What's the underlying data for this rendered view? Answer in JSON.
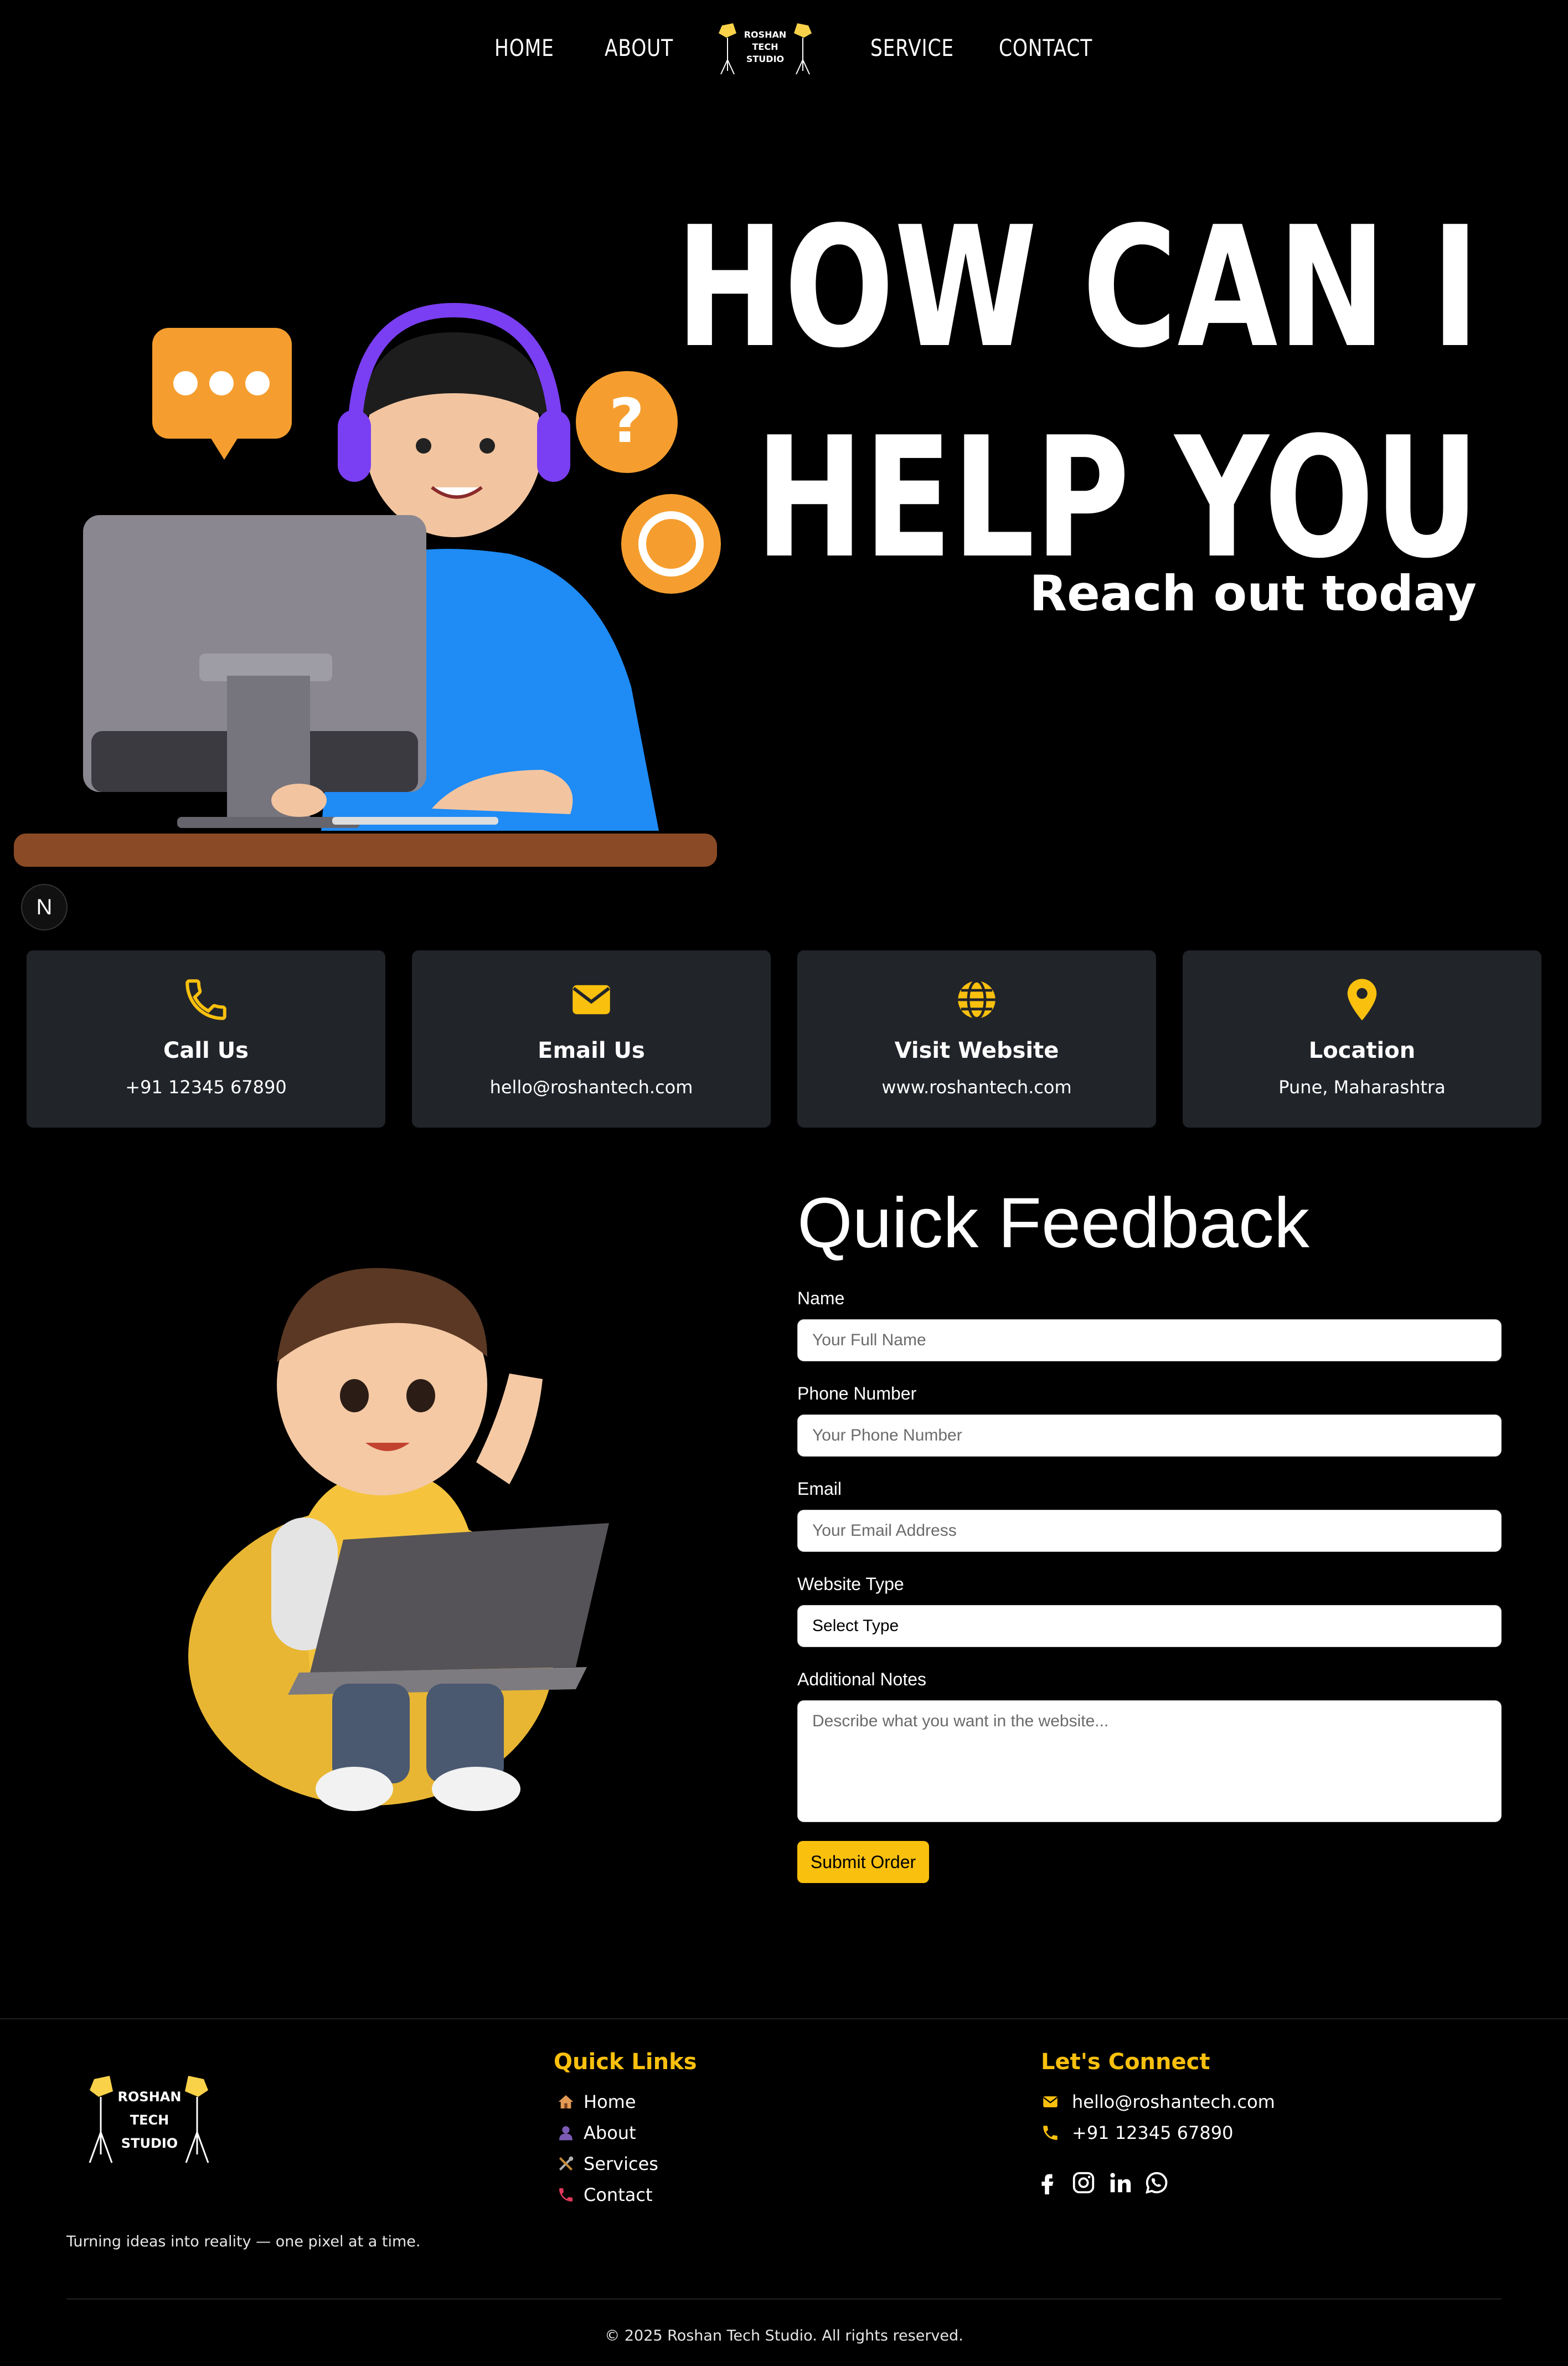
{
  "nav": {
    "links": [
      "HOME",
      "ABOUT",
      "SERVICE",
      "CONTACT"
    ],
    "logo": {
      "line1": "ROSHAN",
      "line2": "TECH",
      "line3": "STUDIO"
    }
  },
  "hero": {
    "title_line1": "HOW CAN I",
    "title_line2": "HELP YOU",
    "subtitle": "Reach out today",
    "badge": "N"
  },
  "cards": [
    {
      "title": "Call Us",
      "value": "+91 12345 67890",
      "icon": "phone-icon"
    },
    {
      "title": "Email Us",
      "value": "hello@roshantech.com",
      "icon": "envelope-icon"
    },
    {
      "title": "Visit Website",
      "value": "www.roshantech.com",
      "icon": "globe-icon"
    },
    {
      "title": "Location",
      "value": "Pune, Maharashtra",
      "icon": "map-pin-icon"
    }
  ],
  "feedback": {
    "title": "Quick Feedback",
    "name_label": "Name",
    "name_placeholder": "Your Full Name",
    "phone_label": "Phone Number",
    "phone_placeholder": "Your Phone Number",
    "email_label": "Email",
    "email_placeholder": "Your Email Address",
    "type_label": "Website Type",
    "type_selected": "Select Type",
    "notes_label": "Additional Notes",
    "notes_placeholder": "Describe what you want in the website...",
    "submit": "Submit Order"
  },
  "footer": {
    "logo": {
      "line1": "ROSHAN",
      "line2": "TECH",
      "line3": "STUDIO"
    },
    "tagline": "Turning ideas into reality — one pixel at a time.",
    "quick_links_title": "Quick Links",
    "quick_links": [
      "Home",
      "About",
      "Services",
      "Contact"
    ],
    "connect_title": "Let's Connect",
    "email": "hello@roshantech.com",
    "phone": "+91 12345 67890",
    "social": [
      "facebook-icon",
      "instagram-icon",
      "linkedin-icon",
      "whatsapp-icon"
    ],
    "copyright": "© 2025 Roshan Tech Studio. All rights reserved."
  },
  "colors": {
    "accent": "#f9c00e",
    "card_bg": "#212429",
    "background": "#000000"
  }
}
